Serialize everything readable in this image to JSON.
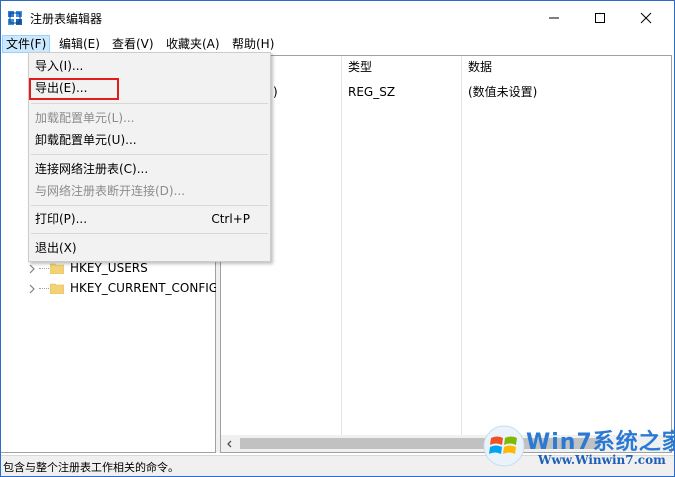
{
  "window": {
    "title": "注册表编辑器"
  },
  "menubar": {
    "items": [
      "文件(F)",
      "编辑(E)",
      "查看(V)",
      "收藏夹(A)",
      "帮助(H)"
    ]
  },
  "file_menu": {
    "import": "导入(I)...",
    "export": "导出(E)...",
    "load_hive": "加载配置单元(L)...",
    "unload_hive": "卸载配置单元(U)...",
    "connect_network": "连接网络注册表(C)...",
    "disconnect_network": "与网络注册表断开连接(D)...",
    "print": "打印(P)...",
    "print_shortcut": "Ctrl+P",
    "exit": "退出(X)"
  },
  "tree": {
    "items": [
      "HKEY_USERS",
      "HKEY_CURRENT_CONFIG"
    ]
  },
  "list": {
    "columns": {
      "type": "类型",
      "data": "数据"
    },
    "rows": [
      {
        "name_fragment": ")",
        "type": "REG_SZ",
        "data": "(数值未设置)"
      }
    ]
  },
  "status": {
    "text": "包含与整个注册表工作相关的命令。"
  },
  "watermark": {
    "brand": "Win7系统之家",
    "url": "Www.Winwin7.com"
  },
  "colors": {
    "accent": "#2b6cc4",
    "menu_active_bg": "#cce8ff",
    "highlight_border": "#e21c1c",
    "dropdown_bg": "#f2f2f2"
  }
}
